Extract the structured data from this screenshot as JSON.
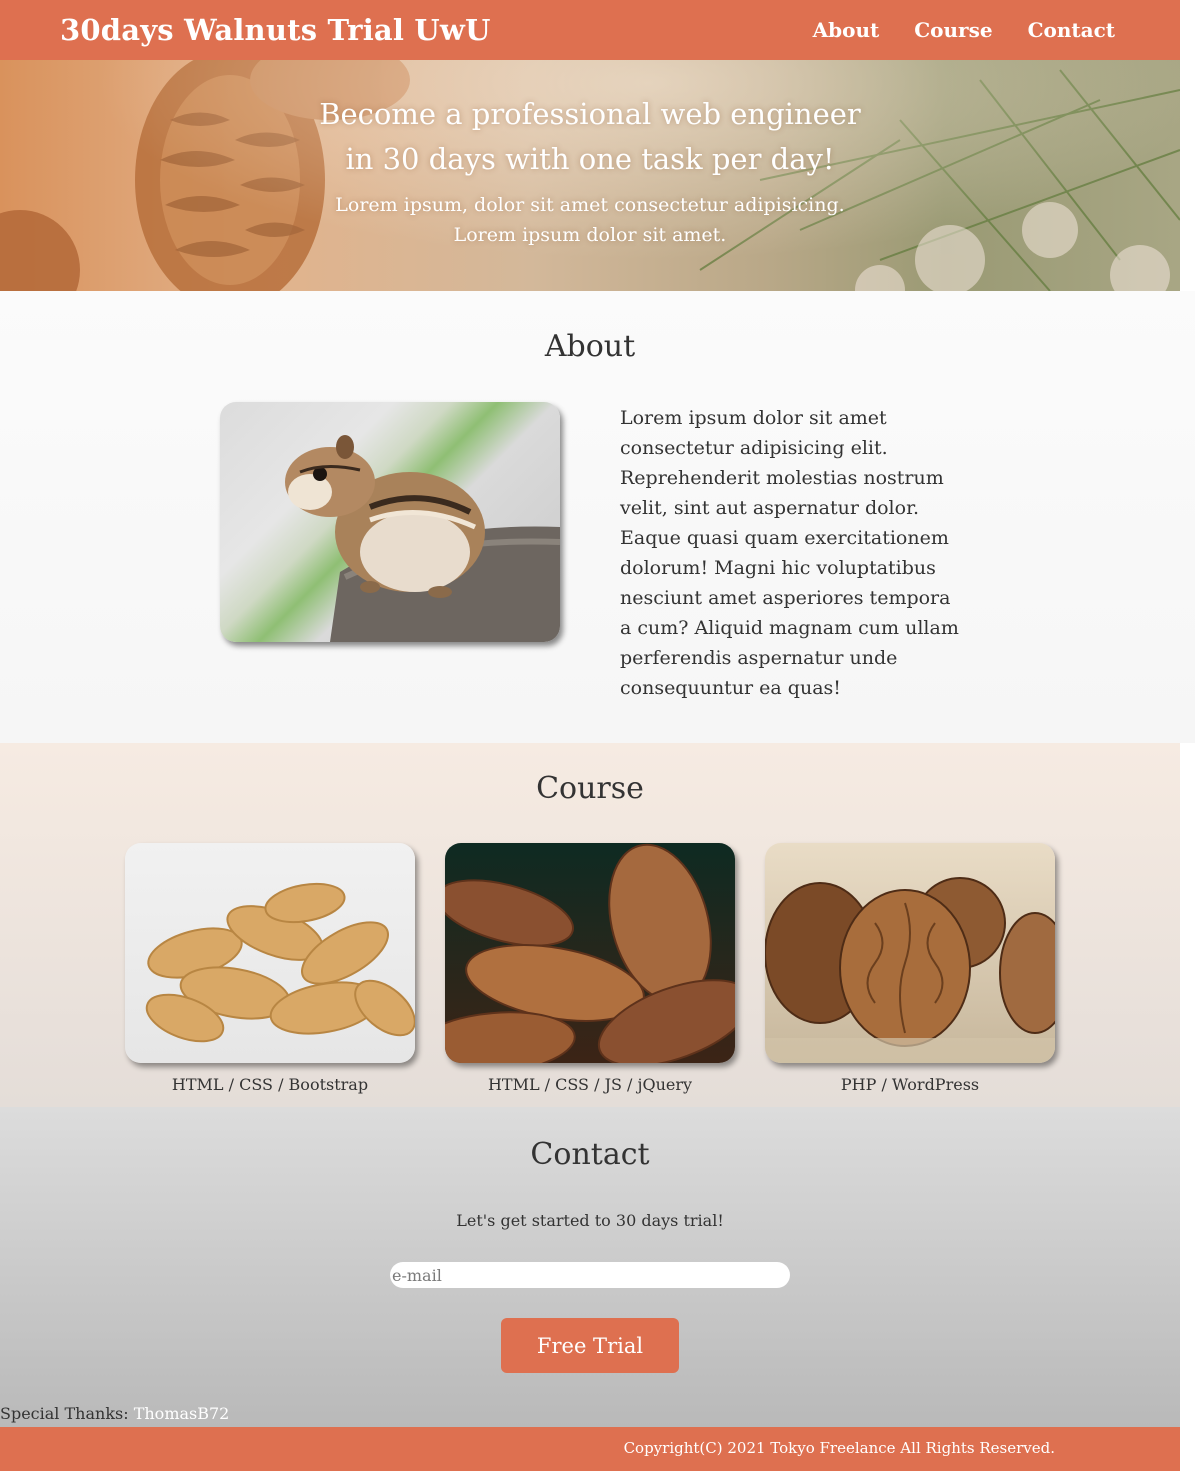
{
  "header": {
    "brand": "30days Walnuts Trial UwU",
    "nav": [
      "About",
      "Course",
      "Contact"
    ]
  },
  "hero": {
    "title_line1": "Become a professional web engineer",
    "title_line2": "in 30 days with one task per day!",
    "sub_line1": "Lorem ipsum, dolor sit amet consectetur adipisicing.",
    "sub_line2": "Lorem ipsum dolor sit amet."
  },
  "about": {
    "title": "About",
    "text": "Lorem ipsum dolor sit amet consectetur adipisicing elit. Reprehenderit molestias nostrum velit, sint aut aspernatur dolor. Eaque quasi quam exercitationem dolorum! Magni hic voluptatibus nesciunt amet asperiores tempora a cum? Aliquid magnam cum ullam perferendis aspernatur unde consequuntur ea quas!"
  },
  "course": {
    "title": "Course",
    "cards": [
      {
        "label": "HTML / CSS / Bootstrap"
      },
      {
        "label": "HTML / CSS / JS / jQuery"
      },
      {
        "label": "PHP / WordPress"
      }
    ]
  },
  "contact": {
    "title": "Contact",
    "lead": "Let's get started to 30 days trial!",
    "email_placeholder": "e-mail",
    "button": "Free Trial",
    "thanks_label": "Special Thanks:",
    "thanks_name": "ThomasB72"
  },
  "footer": {
    "copyright": "Copyright(C) 2021 Tokyo Freelance All Rights Reserved."
  },
  "colors": {
    "accent": "#de7050",
    "header_bg": "#de7050",
    "footer_bg": "#de7050"
  },
  "images": [
    "pine-cone-hero-image",
    "chipmunk-photo",
    "peanuts-photo",
    "almonds-photo",
    "walnuts-photo"
  ]
}
